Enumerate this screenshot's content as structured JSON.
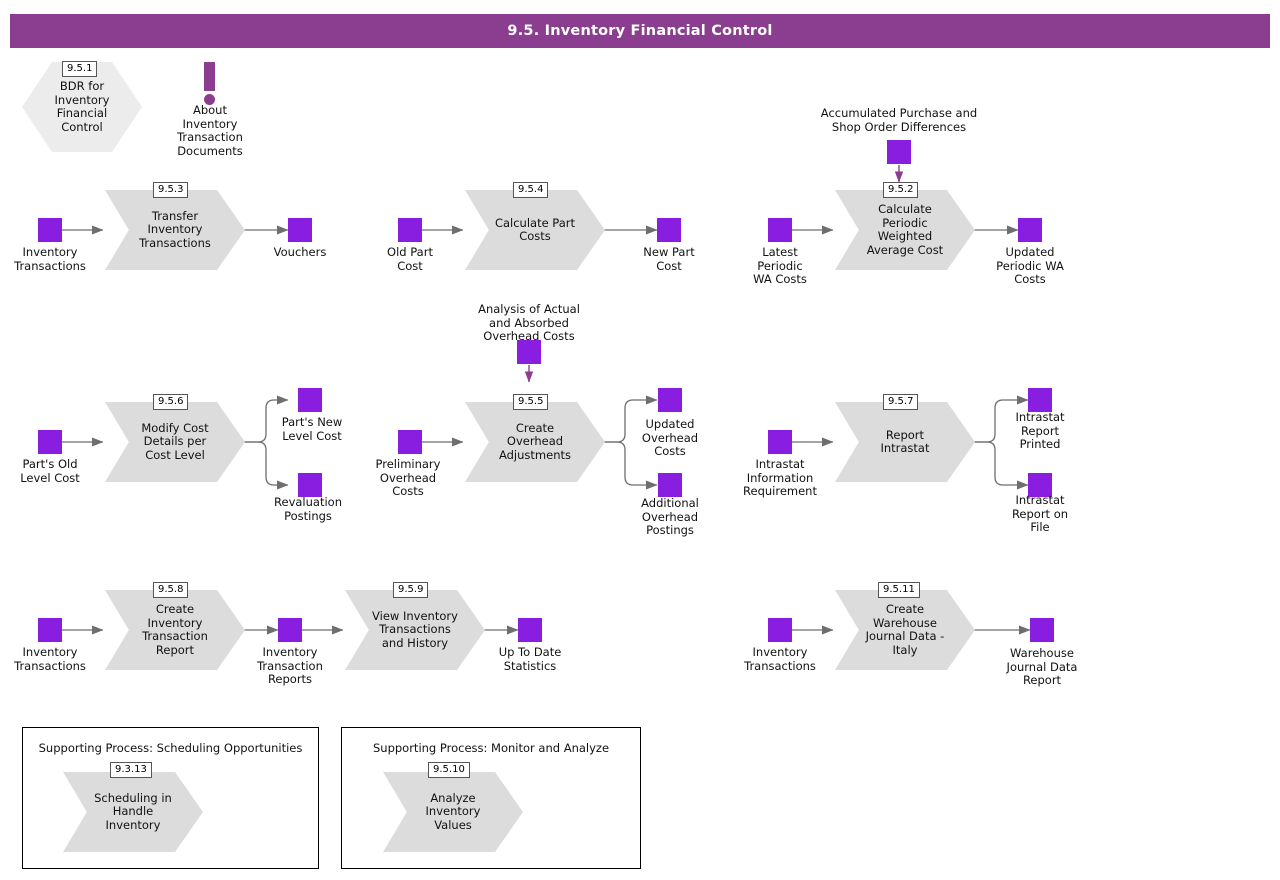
{
  "header": {
    "title": "9.5. Inventory Financial Control",
    "bar_color": "#8B3E8F",
    "text_color": "#ffffff"
  },
  "theme": {
    "data_square_color": "#8A1EE0",
    "process_fill": "#DCDCDC",
    "hexagon_fill": "#ECECEC",
    "connector_color": "#6E6E6E",
    "background": "#ffffff"
  },
  "start_node": {
    "id": "9.5.1",
    "label": "BDR for\nInventory\nFinancial\nControl"
  },
  "about_marker": {
    "icon": "exclamation-icon",
    "label": "About\nInventory\nTransaction\nDocuments"
  },
  "processes": [
    {
      "id": "9.5.3",
      "label": "Transfer\nInventory\nTransactions",
      "inputs": [
        "Inventory\nTransactions"
      ],
      "outputs": [
        "Vouchers"
      ]
    },
    {
      "id": "9.5.4",
      "label": "Calculate Part\nCosts",
      "inputs": [
        "Old Part\nCost"
      ],
      "outputs": [
        "New Part\nCost"
      ]
    },
    {
      "id": "9.5.2",
      "label": "Calculate\nPeriodic\nWeighted\nAverage Cost",
      "inputs": [
        "Latest\nPeriodic\nWA Costs"
      ],
      "top_input": "Accumulated Purchase and\nShop Order Differences",
      "outputs": [
        "Updated\nPeriodic WA\nCosts"
      ]
    },
    {
      "id": "9.5.6",
      "label": "Modify Cost\nDetails per\nCost Level",
      "inputs": [
        "Part's Old\nLevel Cost"
      ],
      "outputs": [
        "Part's New\nLevel Cost",
        "Revaluation\nPostings"
      ]
    },
    {
      "id": "9.5.5",
      "label": "Create\nOverhead\nAdjustments",
      "inputs": [
        "Preliminary\nOverhead\nCosts"
      ],
      "top_input": "Analysis of Actual\nand Absorbed\nOverhead Costs",
      "outputs": [
        "Updated\nOverhead\nCosts",
        "Additional\nOverhead\nPostings"
      ]
    },
    {
      "id": "9.5.7",
      "label": "Report\nIntrastat",
      "inputs": [
        "Intrastat\nInformation\nRequirement"
      ],
      "outputs": [
        "Intrastat\nReport\nPrinted",
        "Intrastat\nReport on\nFile"
      ]
    },
    {
      "id": "9.5.8",
      "label": "Create\nInventory\nTransaction\nReport",
      "inputs": [
        "Inventory\nTransactions"
      ],
      "outputs": [
        "Inventory\nTransaction\nReports"
      ]
    },
    {
      "id": "9.5.9",
      "label": "View Inventory\nTransactions\nand History",
      "inputs": [
        "Inventory\nTransaction\nReports"
      ],
      "outputs": [
        "Up To Date\nStatistics"
      ]
    },
    {
      "id": "9.5.11",
      "label": "Create\nWarehouse\nJournal Data -\nItaly",
      "inputs": [
        "Inventory\nTransactions"
      ],
      "outputs": [
        "Warehouse\nJournal Data\nReport"
      ]
    }
  ],
  "supporting_processes": [
    {
      "title": "Supporting Process: Scheduling Opportunities",
      "node_id": "9.3.13",
      "node_label": "Scheduling in\nHandle\nInventory"
    },
    {
      "title": "Supporting Process: Monitor and Analyze",
      "node_id": "9.5.10",
      "node_label": "Analyze\nInventory\nValues"
    }
  ]
}
